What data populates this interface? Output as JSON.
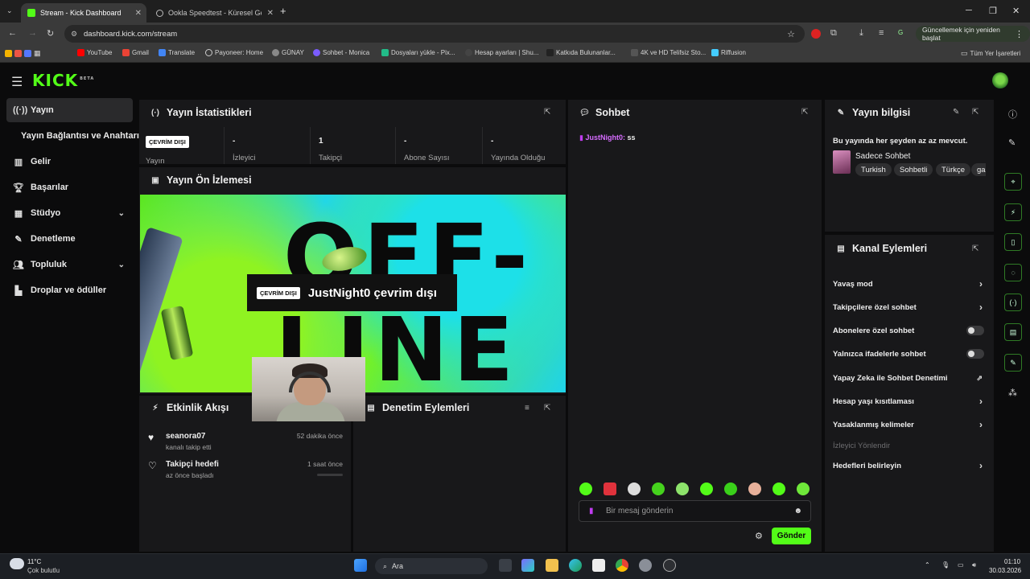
{
  "browser": {
    "tabs": [
      {
        "label": "Stream - Kick Dashboard",
        "active": true
      },
      {
        "label": "Ookla Speedtest - Küresel Geni",
        "active": false
      }
    ],
    "new_tab": "+",
    "url": "dashboard.kick.com/stream",
    "update_button": "Güncellemek için yeniden başlat",
    "profile_initial": "G",
    "bookmarks": [
      "YouTube",
      "Gmail",
      "Translate",
      "Payoneer: Home",
      "GÜNAY",
      "Sohbet - Monica",
      "Dosyaları yükle - Pix...",
      "Hesap ayarları | Shu...",
      "Katkıda Bulunanlar...",
      "4K ve HD Telifsiz Sto...",
      "Riffusion"
    ],
    "all_bookmarks": "Tüm Yer İşaretleri"
  },
  "kick": {
    "logo": "KICK",
    "logo_badge": "BETA",
    "sidebar": [
      {
        "label": "Yayın",
        "icon": "broadcast-icon",
        "active": true
      },
      {
        "label": "Yayın Bağlantısı ve Anahtarı",
        "icon": ""
      },
      {
        "label": "Gelir",
        "icon": "chart-icon"
      },
      {
        "label": "Başarılar",
        "icon": "trophy-icon"
      },
      {
        "label": "Stüdyo",
        "icon": "layout-icon",
        "chevron": true
      },
      {
        "label": "Denetleme",
        "icon": "wrench-icon"
      },
      {
        "label": "Topluluk",
        "icon": "users-icon",
        "chevron": true
      },
      {
        "label": "Droplar ve ödüller",
        "icon": "gift-icon"
      }
    ],
    "stats": {
      "title": "Yayın İstatistikleri",
      "status_badge": "ÇEVRİM DIŞI",
      "status_label": "Yayın",
      "items": [
        {
          "value": "-",
          "label": "İzleyici"
        },
        {
          "value": "1",
          "label": "Takipçi"
        },
        {
          "value": "-",
          "label": "Abone Sayısı"
        },
        {
          "value": "-",
          "label": "Yayında Olduğu"
        }
      ]
    },
    "preview": {
      "title": "Yayın Ön İzlemesi",
      "bg_text_1": "OFF-",
      "bg_text_2": "LINE",
      "offline_badge": "ÇEVRİM DIŞI",
      "offline_text": "JustNight0 çevrim dışı"
    },
    "activity": {
      "title": "Etkinlik Akışı",
      "items": [
        {
          "name": "seanora07",
          "sub": "kanalı takip etti",
          "time": "52 dakika önce"
        },
        {
          "name": "Takipçi hedefi",
          "sub": "az önce başladı",
          "time": "1 saat önce",
          "progress": 0
        }
      ]
    },
    "moderation": {
      "title": "Denetim Eylemleri"
    },
    "chat": {
      "title": "Sohbet",
      "messages": [
        {
          "user": "JustNight0:",
          "text": "ss"
        }
      ],
      "input_placeholder": "Bir mesaj gönderin",
      "send_label": "Gönder"
    },
    "stream_info": {
      "title": "Yayın bilgisi",
      "stream_title": "Bu yayında her şeyden az az mevcut.",
      "category": "Sadece Sohbet",
      "tags": [
        "Turkish",
        "Sohbetli",
        "Türkçe",
        "ga"
      ]
    },
    "channel_actions": {
      "title": "Kanal Eylemleri",
      "rows": [
        {
          "label": "Yavaş mod",
          "control": "arrow"
        },
        {
          "label": "Takipçilere özel sohbet",
          "control": "arrow"
        },
        {
          "label": "Abonelere özel sohbet",
          "control": "toggle",
          "on": false
        },
        {
          "label": "Yalnızca ifadelerle sohbet",
          "control": "toggle",
          "on": false
        },
        {
          "label": "Yapay Zeka ile Sohbet Denetimi",
          "control": "external"
        },
        {
          "label": "Hesap yaşı kısıtlaması",
          "control": "arrow"
        },
        {
          "label": "Yasaklanmış kelimeler",
          "control": "arrow"
        },
        {
          "label": "İzleyici Yönlendir",
          "control": "none",
          "disabled": true
        },
        {
          "label": "Hedefleri belirleyin",
          "control": "arrow"
        }
      ]
    }
  },
  "taskbar": {
    "weather_temp": "11°C",
    "weather_desc": "Çok bulutlu",
    "search_label": "Ara",
    "time": "01:10",
    "date": "30.03.2026"
  },
  "colors": {
    "accent": "#53fc18",
    "panel": "#18181a",
    "background": "#0b0b0c"
  }
}
